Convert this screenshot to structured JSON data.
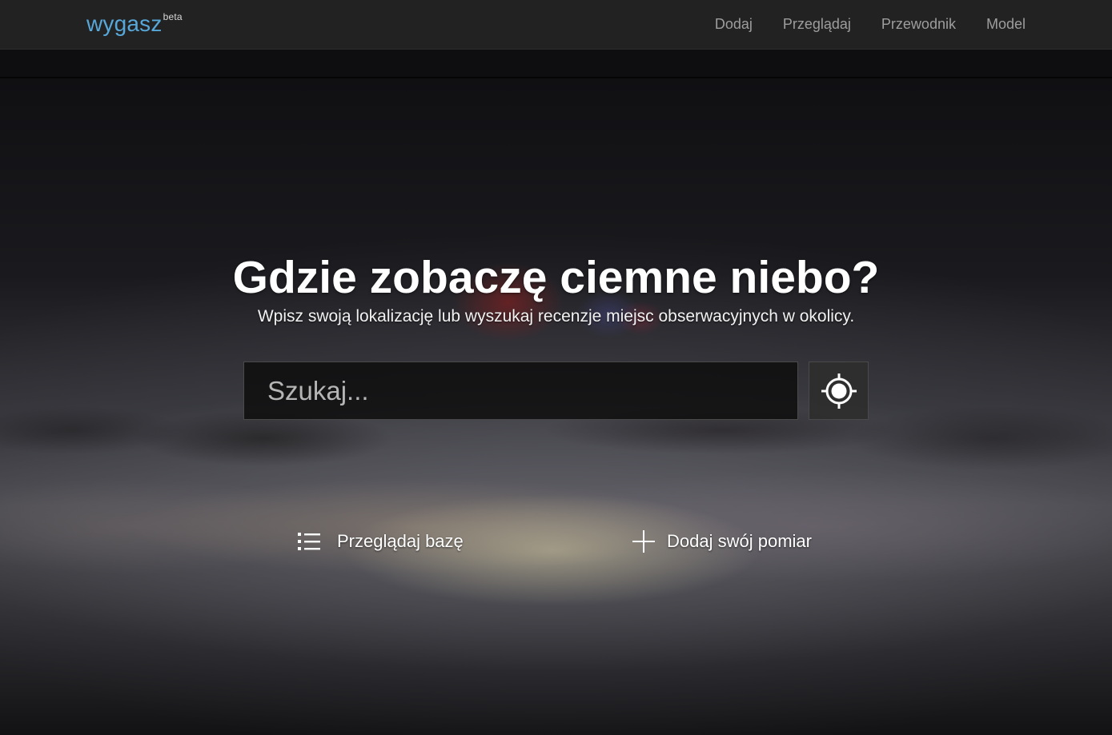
{
  "brand": {
    "name": "wygasz",
    "tag": "beta",
    "color": "#57a8d8"
  },
  "nav": {
    "items": [
      {
        "label": "Dodaj"
      },
      {
        "label": "Przeglądaj"
      },
      {
        "label": "Przewodnik"
      },
      {
        "label": "Model"
      }
    ]
  },
  "hero": {
    "title": "Gdzie zobaczę ciemne niebo?",
    "subtitle": "Wpisz swoją lokalizację lub wyszukaj recenzje miejsc obserwacyjnych w okolicy."
  },
  "search": {
    "placeholder": "Szukaj...",
    "value": "",
    "locate_icon": "crosshair-icon"
  },
  "actions": {
    "browse": {
      "label": "Przeglądaj bazę",
      "icon": "list-icon"
    },
    "add": {
      "label": "Dodaj swój pomiar",
      "icon": "plus-icon"
    }
  }
}
